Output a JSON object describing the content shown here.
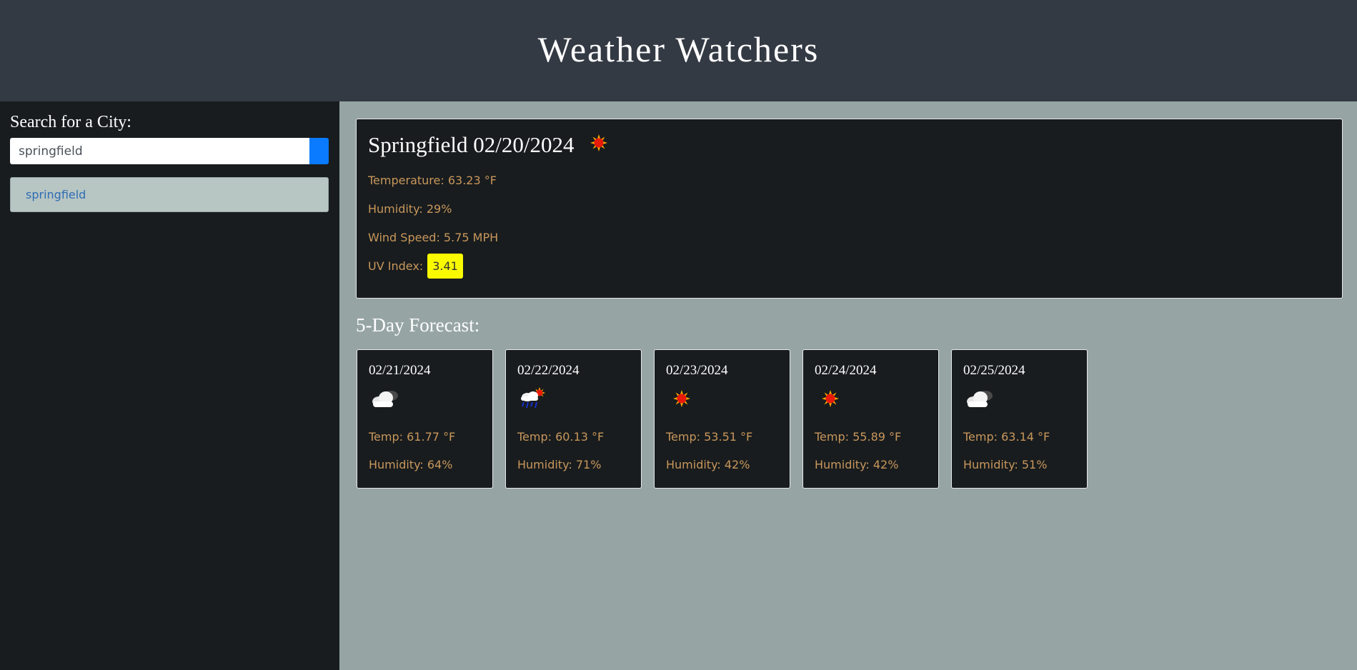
{
  "header": {
    "title": "Weather Watchers"
  },
  "sidebar": {
    "label": "Search for a City:",
    "search_value": "springfield",
    "history": [
      "springfield"
    ]
  },
  "current": {
    "title": "Springfield 02/20/2024",
    "icon": "sun-icon",
    "temperature": "Temperature: 63.23 °F",
    "humidity": "Humidity: 29%",
    "wind": "Wind Speed: 5.75 MPH",
    "uv_label": "UV Index:",
    "uv_value": "3.41",
    "uv_color": "#f9fa00"
  },
  "forecast": {
    "heading": "5-Day Forecast:",
    "days": [
      {
        "date": "02/21/2024",
        "icon": "cloud-icon",
        "temp": "Temp: 61.77 °F",
        "humidity": "Humidity: 64%"
      },
      {
        "date": "02/22/2024",
        "icon": "rain-sun-icon",
        "temp": "Temp: 60.13 °F",
        "humidity": "Humidity: 71%"
      },
      {
        "date": "02/23/2024",
        "icon": "sun-icon",
        "temp": "Temp: 53.51 °F",
        "humidity": "Humidity: 42%"
      },
      {
        "date": "02/24/2024",
        "icon": "sun-icon",
        "temp": "Temp: 55.89 °F",
        "humidity": "Humidity: 42%"
      },
      {
        "date": "02/25/2024",
        "icon": "cloud-icon",
        "temp": "Temp: 63.14 °F",
        "humidity": "Humidity: 51%"
      }
    ]
  },
  "colors": {
    "header": "#343a44",
    "sidebar": "#181c1e",
    "main": "#96a4a4",
    "accent": "#0a7bff",
    "stat_text": "#c8975c"
  }
}
